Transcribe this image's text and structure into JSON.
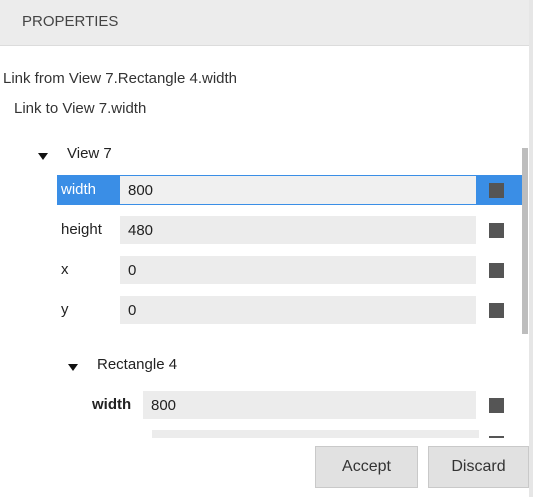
{
  "header": {
    "title": "PROPERTIES"
  },
  "link": {
    "from": "Link from View 7.Rectangle 4.width",
    "to": "Link to View 7.width"
  },
  "tree": {
    "view": {
      "label": "View 7",
      "properties": [
        {
          "name": "width",
          "value": "800",
          "selected": true
        },
        {
          "name": "height",
          "value": "480"
        },
        {
          "name": "x",
          "value": "0"
        },
        {
          "name": "y",
          "value": "0"
        }
      ]
    },
    "child": {
      "label": "Rectangle 4",
      "properties": [
        {
          "name": "width",
          "value": "800"
        }
      ]
    }
  },
  "buttons": {
    "accept": "Accept",
    "discard": "Discard"
  }
}
